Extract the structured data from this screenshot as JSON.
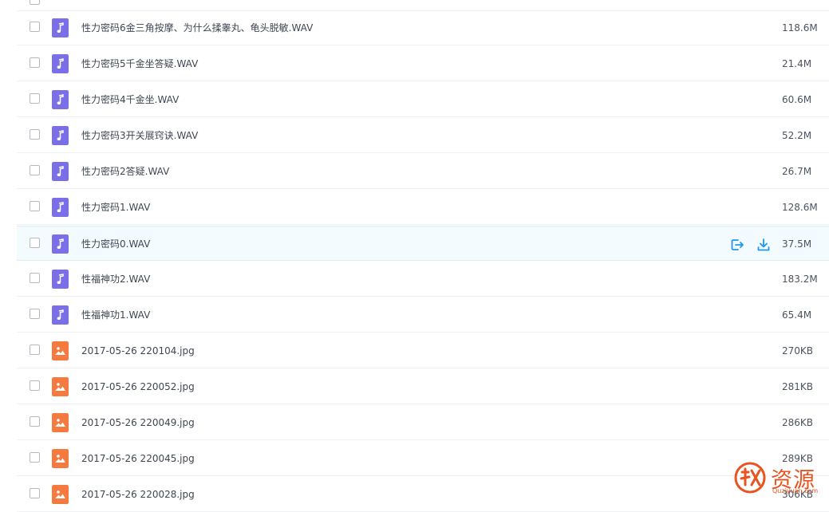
{
  "files": [
    {
      "name": "性力密码6金三角按摩、为什么揉睾丸、龟头脱敏.WAV",
      "size": "118.6M",
      "type": "audio"
    },
    {
      "name": "性力密码5千金坐答疑.WAV",
      "size": "21.4M",
      "type": "audio"
    },
    {
      "name": "性力密码4千金坐.WAV",
      "size": "60.6M",
      "type": "audio"
    },
    {
      "name": "性力密码3开关展窍诀.WAV",
      "size": "52.2M",
      "type": "audio"
    },
    {
      "name": "性力密码2答疑.WAV",
      "size": "26.7M",
      "type": "audio"
    },
    {
      "name": "性力密码1.WAV",
      "size": "128.6M",
      "type": "audio"
    },
    {
      "name": "性力密码0.WAV",
      "size": "37.5M",
      "type": "audio",
      "hovered": true
    },
    {
      "name": "性福神功2.WAV",
      "size": "183.2M",
      "type": "audio"
    },
    {
      "name": "性福神功1.WAV",
      "size": "65.4M",
      "type": "audio"
    },
    {
      "name": "2017-05-26 220104.jpg",
      "size": "270KB",
      "type": "image"
    },
    {
      "name": "2017-05-26 220052.jpg",
      "size": "281KB",
      "type": "image"
    },
    {
      "name": "2017-05-26 220049.jpg",
      "size": "286KB",
      "type": "image"
    },
    {
      "name": "2017-05-26 220045.jpg",
      "size": "289KB",
      "type": "image"
    },
    {
      "name": "2017-05-26 220028.jpg",
      "size": "306KB",
      "type": "image"
    }
  ],
  "row_actions": {
    "share_icon": "share-icon",
    "download_icon": "download-icon"
  },
  "colors": {
    "audio_icon": "#7b6fe8",
    "image_icon": "#f47a3f",
    "accent": "#1a9af0",
    "watermark": "#e8531f"
  },
  "watermark": {
    "main": "资源",
    "sub": "Quziyuan.com"
  }
}
